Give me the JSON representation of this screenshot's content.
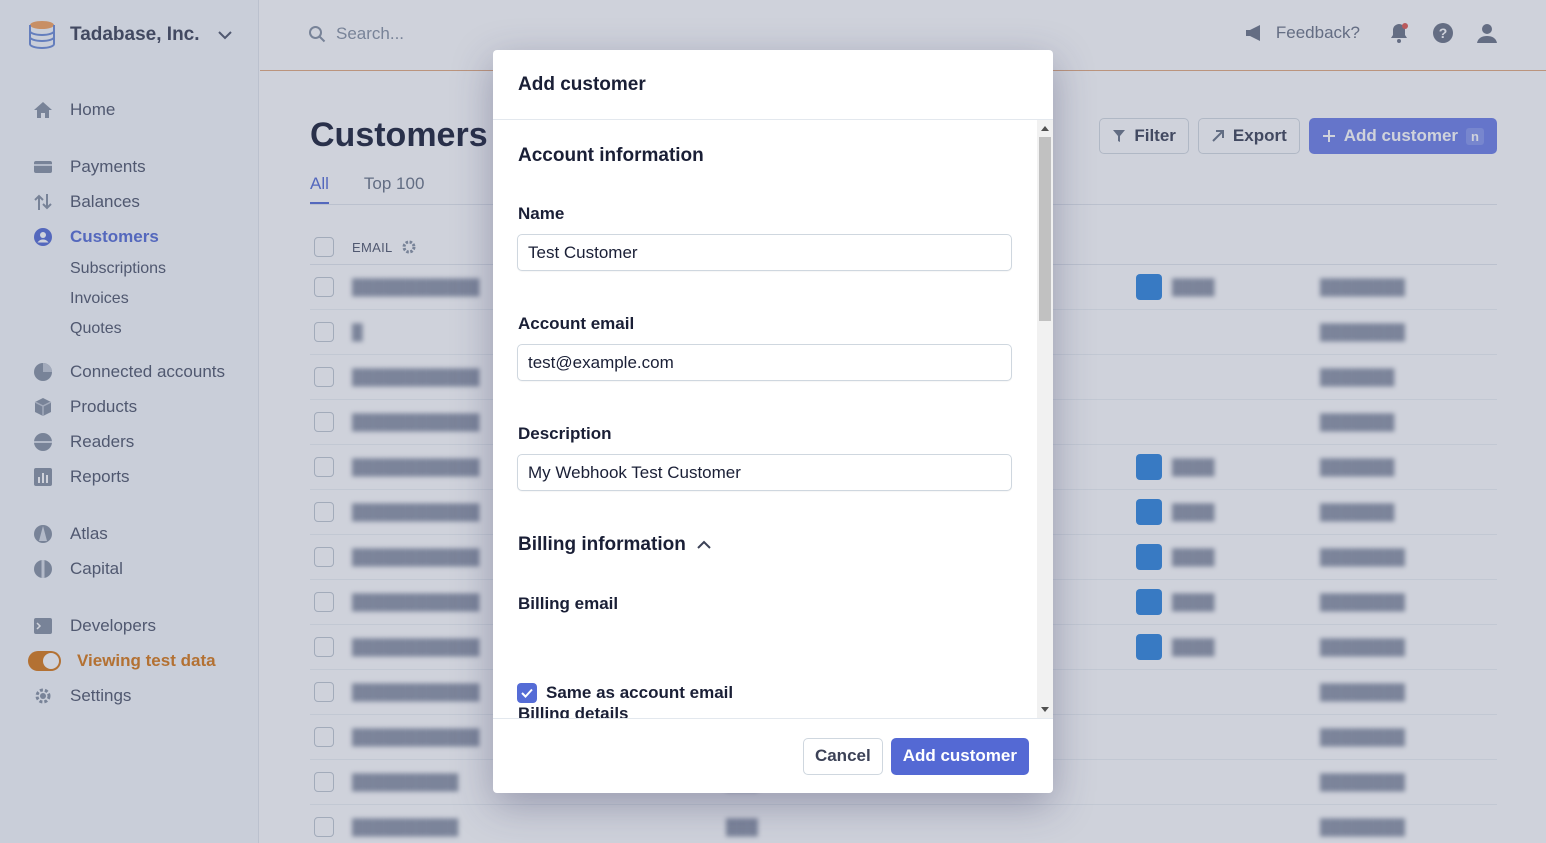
{
  "app": {
    "org_name": "Tadabase, Inc."
  },
  "sidebar": {
    "items": [
      {
        "label": "Home",
        "icon": "home-icon"
      },
      {
        "label": "Payments",
        "icon": "payments-icon"
      },
      {
        "label": "Balances",
        "icon": "balances-icon"
      },
      {
        "label": "Customers",
        "icon": "customers-icon",
        "active": true
      },
      {
        "label": "Connected accounts",
        "icon": "connected-accounts-icon"
      },
      {
        "label": "Products",
        "icon": "products-icon"
      },
      {
        "label": "Readers",
        "icon": "readers-icon"
      },
      {
        "label": "Reports",
        "icon": "reports-icon"
      },
      {
        "label": "Atlas",
        "icon": "atlas-icon"
      },
      {
        "label": "Capital",
        "icon": "capital-icon"
      },
      {
        "label": "Developers",
        "icon": "developers-icon"
      },
      {
        "label": "Viewing test data",
        "icon": "toggle"
      },
      {
        "label": "Settings",
        "icon": "gear-icon"
      }
    ],
    "customer_subitems": [
      "Subscriptions",
      "Invoices",
      "Quotes"
    ]
  },
  "topbar": {
    "search_placeholder": "Search...",
    "feedback": "Feedback?"
  },
  "page": {
    "title": "Customers",
    "tabs": [
      "All",
      "Top 100"
    ],
    "actions": {
      "filter": "Filter",
      "export": "Export",
      "add_customer": "Add customer",
      "add_customer_shortcut": "n"
    },
    "table": {
      "email_header": "EMAIL"
    }
  },
  "modal": {
    "title": "Add customer",
    "account_section": "Account information",
    "name_label": "Name",
    "name_value": "Test Customer",
    "email_label": "Account email",
    "email_value": "test@example.com",
    "description_label": "Description",
    "description_value": "My Webhook Test Customer",
    "billing_section": "Billing information",
    "billing_email_label": "Billing email",
    "same_as_account": "Same as account email",
    "same_as_account_checked": true,
    "billing_details_label": "Billing details",
    "cancel": "Cancel",
    "submit": "Add customer"
  },
  "colors": {
    "accent": "#556cd6",
    "test_mode": "#d97917",
    "overlay": "#525f7f"
  }
}
